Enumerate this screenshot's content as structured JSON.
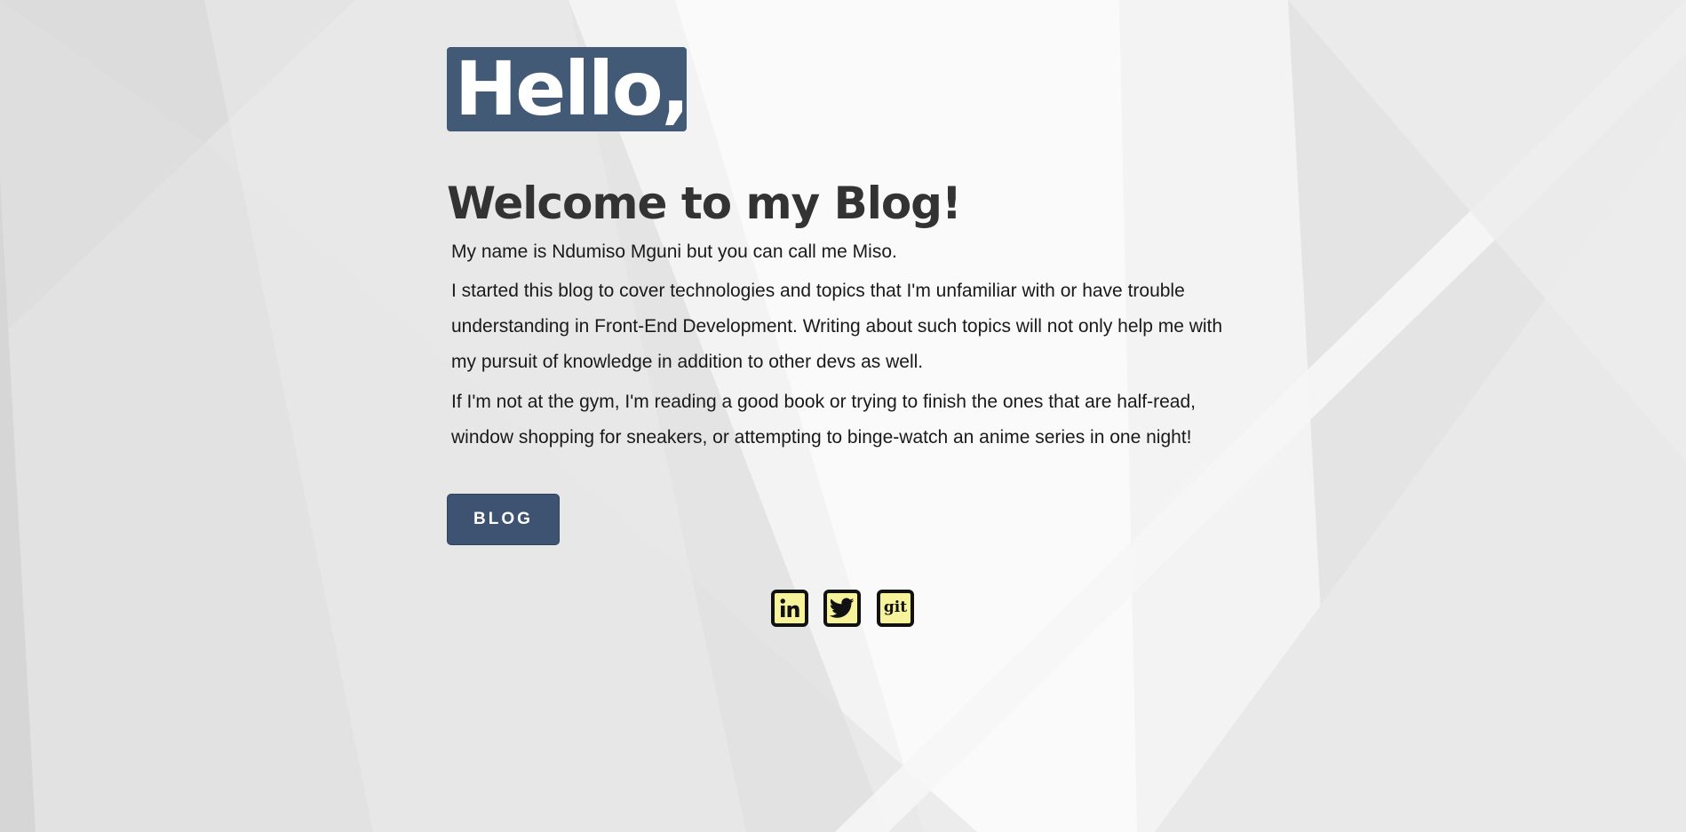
{
  "hero": {
    "greeting": "Hello,",
    "heading": "Welcome to my Blog!"
  },
  "intro": {
    "paragraphs": [
      "My name is Ndumiso Mguni but you can call me Miso.",
      "I started this blog to cover technologies and topics that I'm unfamiliar with or have trouble understanding in Front-End Development. Writing about such topics will not only help me with my pursuit of knowledge in addition to other devs as well.",
      "If I'm not at the gym, I'm reading a good book or trying to finish the ones that are half-read, window shopping for sneakers, or attempting to binge-watch an anime series in one night!"
    ]
  },
  "actions": {
    "blog_label": "BLOG"
  },
  "social": {
    "items": [
      {
        "name": "linkedin",
        "icon": "linkedin-icon"
      },
      {
        "name": "twitter",
        "icon": "twitter-icon"
      },
      {
        "name": "git",
        "icon": "git-icon",
        "label": "git"
      }
    ]
  },
  "colors": {
    "accent": "#435a76",
    "button": "#3d5371",
    "heading": "#333333",
    "icon_fill": "#f6f39a",
    "icon_border": "#111111"
  }
}
